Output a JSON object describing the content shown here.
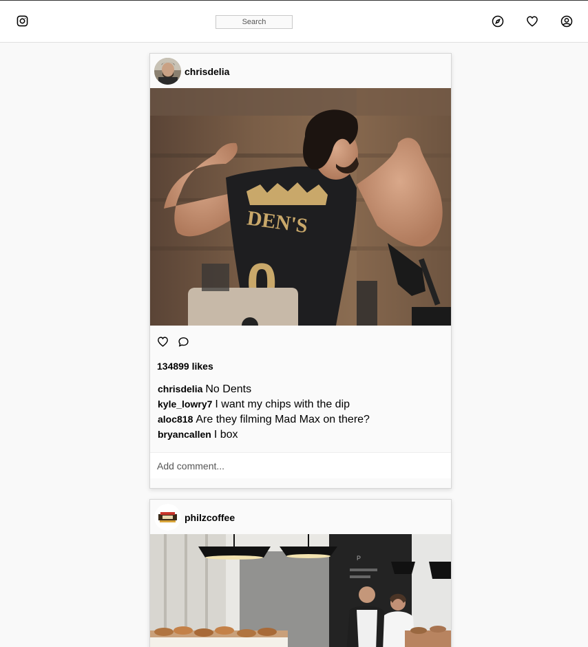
{
  "header": {
    "search_label": "Search",
    "icons": [
      "instagram-icon",
      "compass-icon",
      "heart-icon",
      "user-circle-icon"
    ]
  },
  "posts": [
    {
      "username": "chrisdelia",
      "likes": "134899 likes",
      "comments": [
        {
          "user": "chrisdelia",
          "text": "No Dents"
        },
        {
          "user": "kyle_lowry7",
          "text": "I want my chips with the dip"
        },
        {
          "user": "aloc818",
          "text": "Are they filming Mad Max on there?"
        },
        {
          "user": "bryancallen",
          "text": "I box"
        }
      ],
      "add_comment_placeholder": "Add comment..."
    },
    {
      "username": "philzcoffee"
    }
  ]
}
